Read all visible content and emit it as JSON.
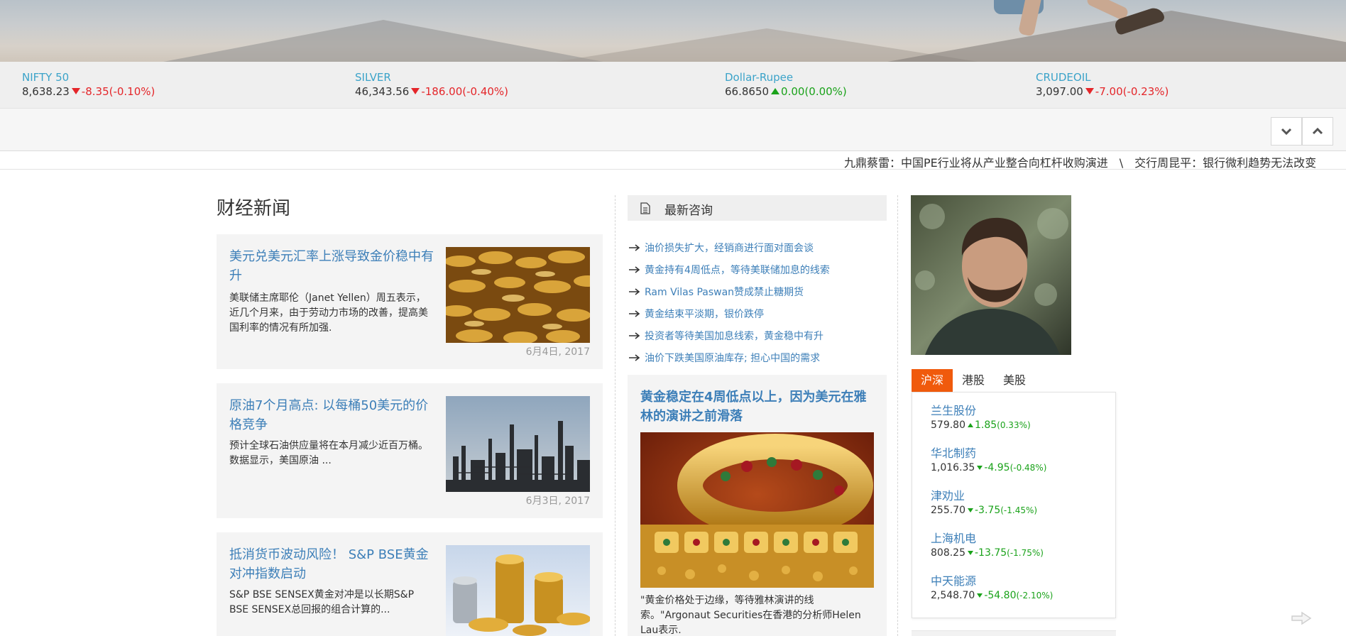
{
  "market": [
    {
      "name": "NIFTY 50",
      "value": "8,638.23",
      "change": "-8.35(-0.10%)",
      "direction": "down"
    },
    {
      "name": "SILVER",
      "value": "46,343.56",
      "change": "-186.00(-0.40%)",
      "direction": "down"
    },
    {
      "name": "Dollar-Rupee",
      "value": "66.8650",
      "change": "0.00(0.00%)",
      "direction": "up"
    },
    {
      "name": "CRUDEOIL",
      "value": "3,097.00",
      "change": "-7.00(-0.23%)",
      "direction": "down"
    }
  ],
  "controls": {
    "down_icon": "chevron-down-icon",
    "up_icon": "chevron-up-icon"
  },
  "marquee": {
    "items": [
      "九鼎蔡雷：中国PE行业将从产业整合向杠杆收购演进",
      "交行周昆平：银行微利趋势无法改变"
    ],
    "separator": "\\"
  },
  "finance_news": {
    "title": "财经新闻",
    "items": [
      {
        "title": "美元兑美元汇率上涨导致金价稳中有升",
        "body": "美联储主席耶伦（Janet Yellen）周五表示，近几个月来，由于劳动力市场的改善，提高美国利率的情况有所加强.",
        "date": "6月4日, 2017"
      },
      {
        "title": "原油7个月高点: 以每桶50美元的价格竞争",
        "body": "预计全球石油供应量将在本月减少近百万桶。\n数据显示，美国原油 ...",
        "date": "6月3日, 2017"
      },
      {
        "title": "抵消货币波动风险！ S&P BSE黄金对冲指数启动",
        "body": "S&P BSE SENSEX黄金对冲是以长期S&P BSE SENSEX总回报的组合计算的...",
        "date": ""
      }
    ]
  },
  "advisory": {
    "title": "最新咨询",
    "items": [
      "油价损失扩大，经销商进行面对面会谈",
      "黄金持有4周低点，等待美联储加息的线索",
      "Ram Vilas Paswan赞成禁止糖期货",
      "黄金结束平淡期，银价跌停",
      "投资者等待美国加息线索，黄金稳中有升",
      "油价下跌美国原油库存; 担心中国的需求"
    ]
  },
  "featured": {
    "title": "黄金稳定在4周低点以上，因为美元在雅林的演讲之前滑落",
    "body": "\"黄金价格处于边缘，等待雅林演讲的线索。\"Argonaut Securities在香港的分析师Helen Lau表示."
  },
  "stock_tabs": {
    "items": [
      "沪深",
      "港股",
      "美股"
    ],
    "active": 0
  },
  "stocks": [
    {
      "name": "兰生股份",
      "value": "579.80",
      "change": "1.85",
      "pct": "(0.33%)",
      "direction": "up"
    },
    {
      "name": "华北制药",
      "value": "1,016.35",
      "change": "-4.95",
      "pct": "(-0.48%)",
      "direction": "down"
    },
    {
      "name": "津劝业",
      "value": "255.70",
      "change": "-3.75",
      "pct": "(-1.45%)",
      "direction": "down"
    },
    {
      "name": "上海机电",
      "value": "808.25",
      "change": "-13.75",
      "pct": "(-1.75%)",
      "direction": "down"
    },
    {
      "name": "中天能源",
      "value": "2,548.70",
      "change": "-54.80",
      "pct": "(-2.10%)",
      "direction": "down"
    }
  ],
  "colors": {
    "accent": "#f05a0c",
    "link": "#3d7fb8",
    "ticker_name": "#3ba3c9",
    "down": "#e4262a",
    "up": "#1aa21a"
  }
}
